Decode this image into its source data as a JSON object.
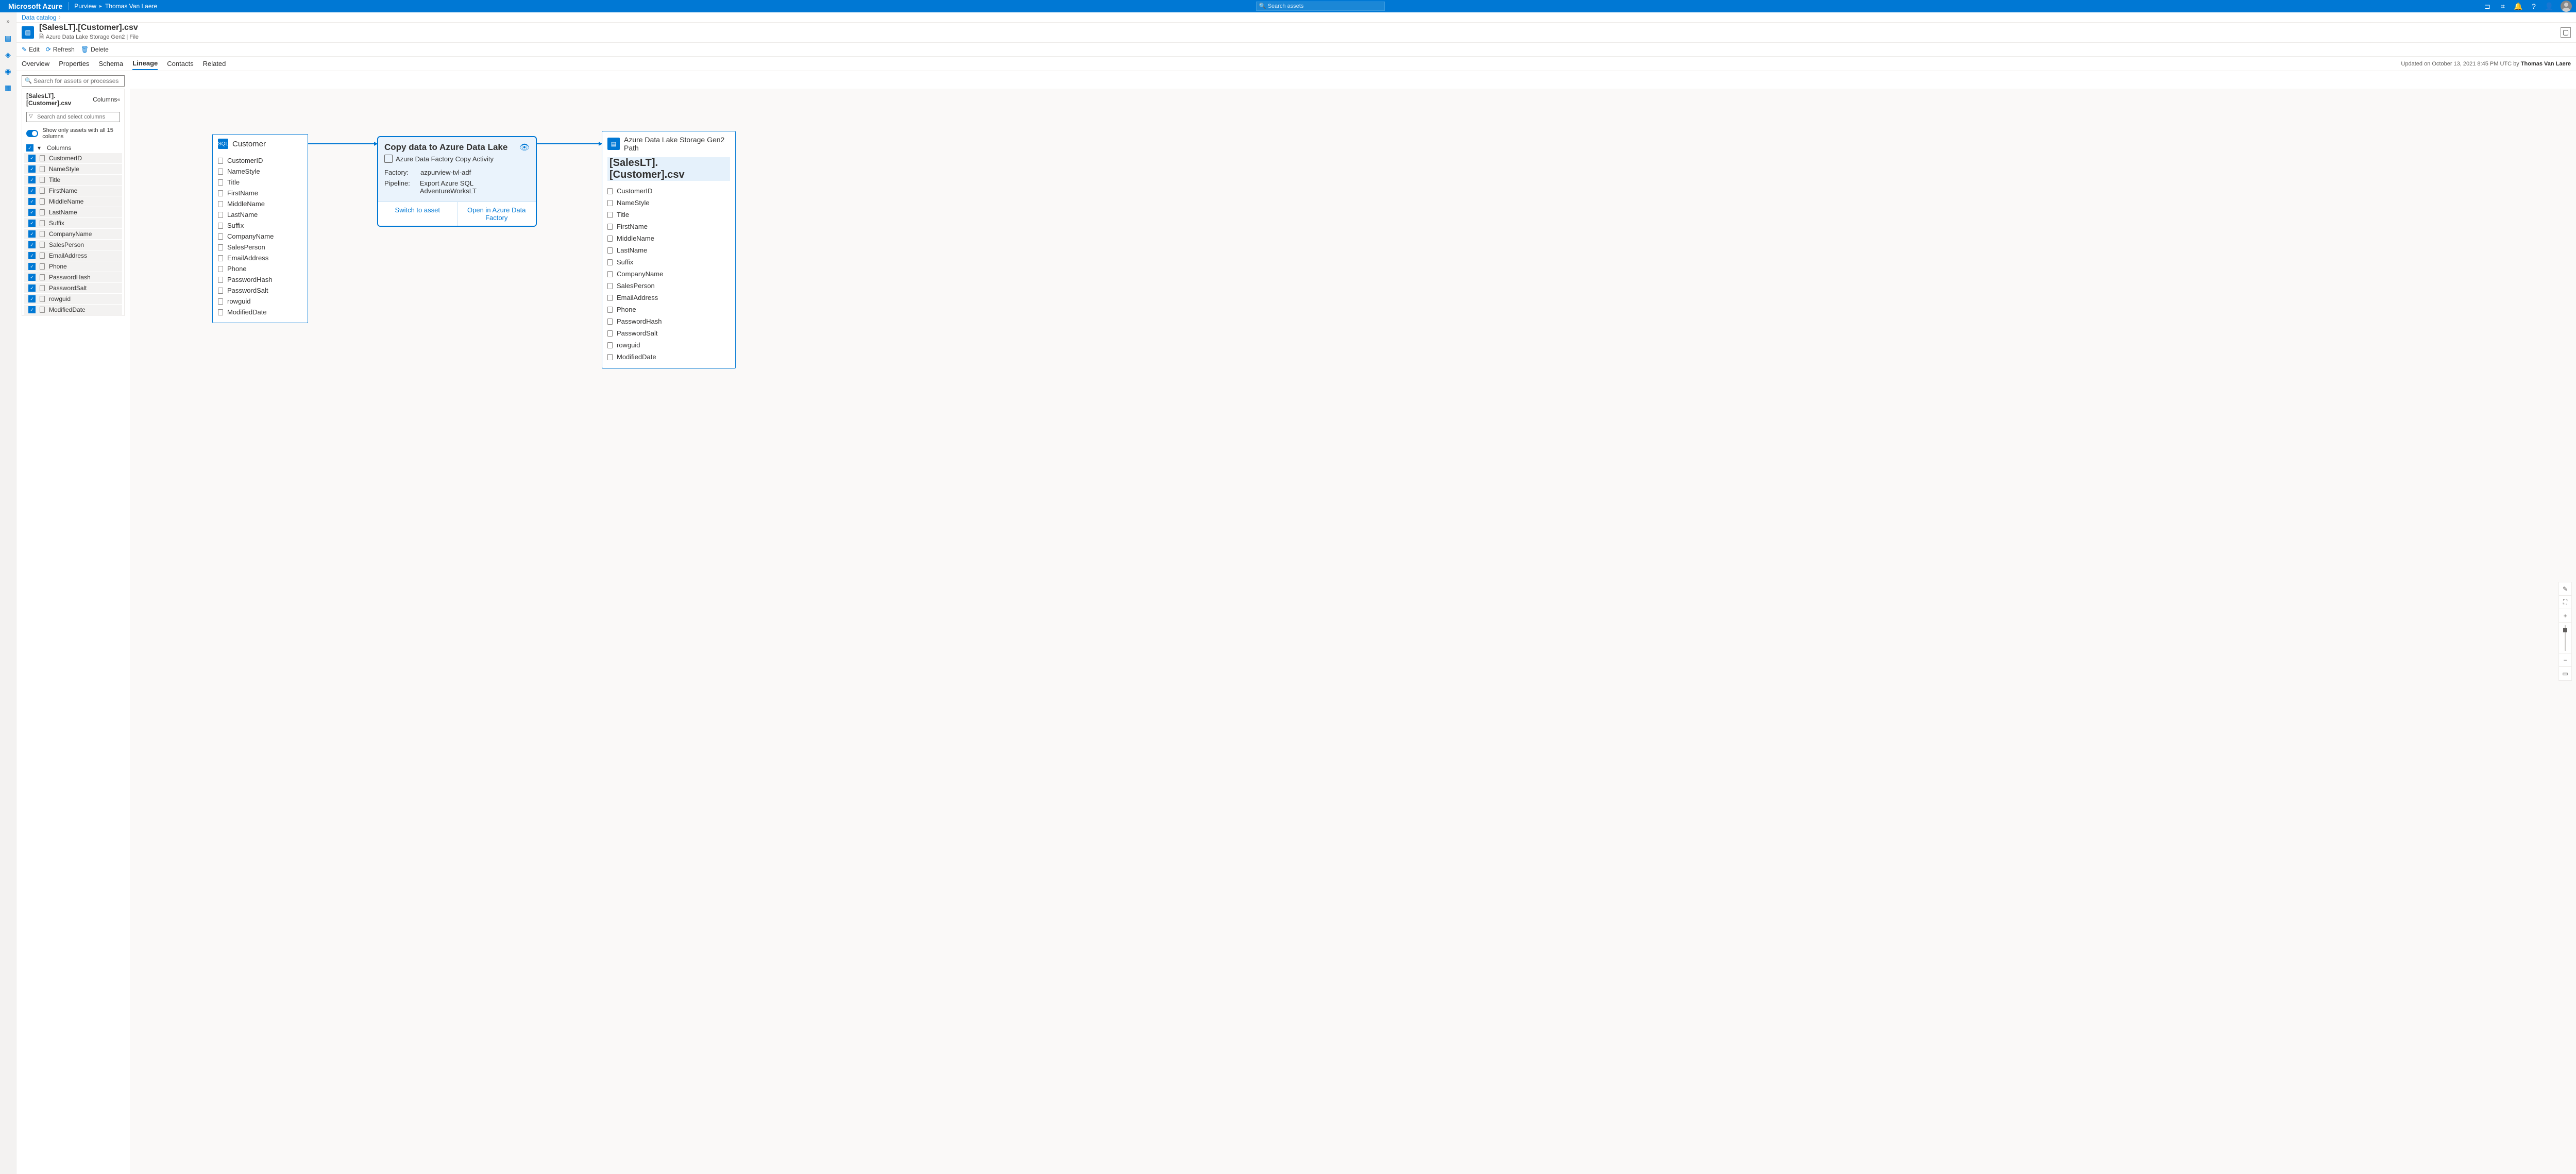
{
  "header": {
    "brand": "Microsoft Azure",
    "service": "Purview",
    "user": "Thomas Van Laere",
    "search_placeholder": "Search assets"
  },
  "breadcrumb": {
    "root": "Data catalog"
  },
  "asset": {
    "title": "[SalesLT].[Customer].csv",
    "subtitle": "Azure Data Lake Storage Gen2 | File"
  },
  "commands": {
    "edit": "Edit",
    "refresh": "Refresh",
    "delete": "Delete"
  },
  "tabs": {
    "overview": "Overview",
    "properties": "Properties",
    "schema": "Schema",
    "lineage": "Lineage",
    "contacts": "Contacts",
    "related": "Related"
  },
  "updated": {
    "prefix": "Updated on October 13, 2021 8:45 PM UTC by ",
    "by": "Thomas Van Laere"
  },
  "search": {
    "assets_placeholder": "Search for assets or processes"
  },
  "left_panel": {
    "title": "[SalesLT].[Customer].csv",
    "title_suffix": "Columns",
    "filter_placeholder": "Search and select columns",
    "toggle_label": "Show only assets with all 15 columns",
    "group_label": "Columns",
    "columns": [
      "CustomerID",
      "NameStyle",
      "Title",
      "FirstName",
      "MiddleName",
      "LastName",
      "Suffix",
      "CompanyName",
      "SalesPerson",
      "EmailAddress",
      "Phone",
      "PasswordHash",
      "PasswordSalt",
      "rowguid",
      "ModifiedDate"
    ]
  },
  "lineage": {
    "source": {
      "title": "Customer",
      "columns": [
        "CustomerID",
        "NameStyle",
        "Title",
        "FirstName",
        "MiddleName",
        "LastName",
        "Suffix",
        "CompanyName",
        "SalesPerson",
        "EmailAddress",
        "Phone",
        "PasswordHash",
        "PasswordSalt",
        "rowguid",
        "ModifiedDate"
      ]
    },
    "activity": {
      "title": "Copy data to Azure Data Lake",
      "subtitle": "Azure Data Factory Copy Activity",
      "factory_label": "Factory:",
      "factory_value": "azpurview-tvl-adf",
      "pipeline_label": "Pipeline:",
      "pipeline_value": "Export Azure SQL AdventureWorksLT",
      "switch_btn": "Switch to asset",
      "open_btn": "Open in Azure Data Factory"
    },
    "dest": {
      "type_line1": "Azure Data Lake Storage Gen2",
      "type_line2": "Path",
      "title": "[SalesLT].[Customer].csv",
      "columns": [
        "CustomerID",
        "NameStyle",
        "Title",
        "FirstName",
        "MiddleName",
        "LastName",
        "Suffix",
        "CompanyName",
        "SalesPerson",
        "EmailAddress",
        "Phone",
        "PasswordHash",
        "PasswordSalt",
        "rowguid",
        "ModifiedDate"
      ]
    }
  }
}
